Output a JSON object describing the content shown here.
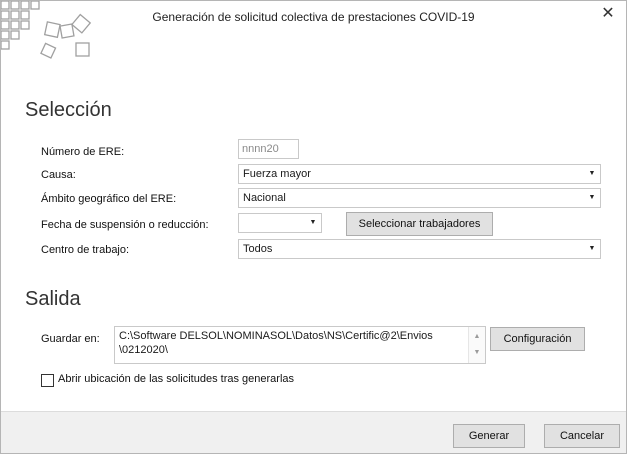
{
  "window": {
    "title": "Generación de solicitud colectiva de prestaciones COVID-19",
    "close_glyph": "✕"
  },
  "seleccion": {
    "heading": "Selección",
    "numero_ere": {
      "label": "Número de ERE:",
      "placeholder": "nnnn20"
    },
    "causa": {
      "label": "Causa:",
      "value": "Fuerza mayor"
    },
    "ambito": {
      "label": "Ámbito geográfico del ERE:",
      "value": "Nacional"
    },
    "fecha": {
      "label": "Fecha de suspensión o reducción:",
      "value": ""
    },
    "seleccionar_button": "Seleccionar trabajadores",
    "centro": {
      "label": "Centro de trabajo:",
      "value": "Todos"
    }
  },
  "salida": {
    "heading": "Salida",
    "guardar": {
      "label": "Guardar en:",
      "value": "C:\\Software DELSOL\\NOMINASOL\\Datos\\NS\\Certific@2\\Envios\n\\0212020\\"
    },
    "configuracion_button": "Configuración",
    "abrir_checkbox": {
      "label": "Abrir ubicación de las solicitudes tras generarlas",
      "checked": false
    }
  },
  "footer": {
    "generar_button": "Generar",
    "cancelar_button": "Cancelar"
  },
  "icons": {
    "dropdown": "chevron-down-icon",
    "close": "close-icon",
    "scroll_up": "scroll-up-icon",
    "scroll_down": "scroll-down-icon"
  },
  "colors": {
    "logo_gray": "#a0a0a0",
    "button_bg": "#e1e1e1",
    "footer_bg": "#f0f0f0"
  }
}
